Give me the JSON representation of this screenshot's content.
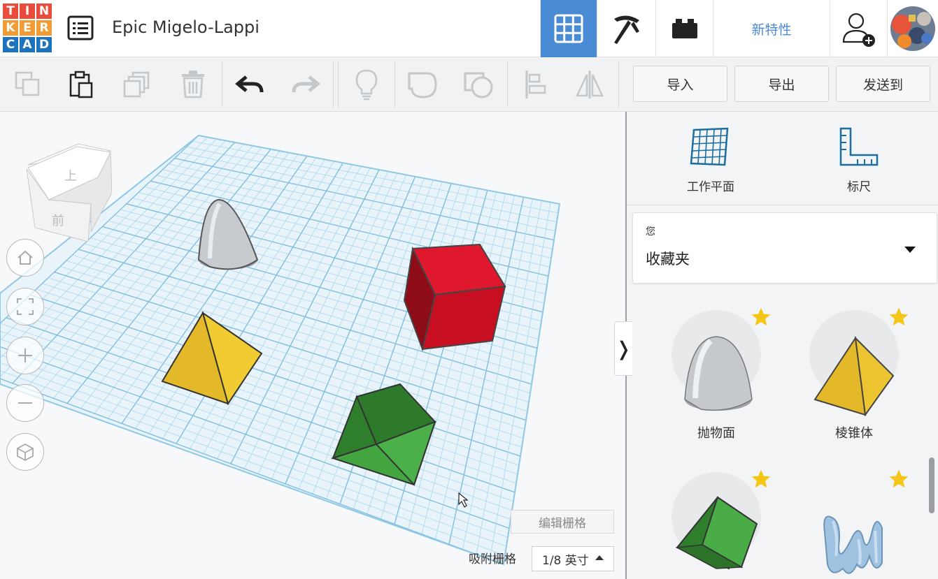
{
  "logo": {
    "letters": [
      "T",
      "I",
      "N",
      "K",
      "E",
      "R",
      "C",
      "A",
      "D"
    ],
    "colors": [
      "#e94b3c",
      "#e94b3c",
      "#e94b3c",
      "#f39c33",
      "#f39c33",
      "#f39c33",
      "#1e73be",
      "#1e73be",
      "#1e73be"
    ]
  },
  "header": {
    "project_title": "Epic Migelo-Lappi",
    "whats_new": "新特性"
  },
  "toolbar": {
    "import": "导入",
    "export": "导出",
    "send_to": "发送到"
  },
  "viewcube": {
    "top": "上",
    "front": "前"
  },
  "viewport": {
    "edit_grid": "编辑栅格",
    "snap_label": "吸附栅格",
    "snap_value": "1/8 英寸"
  },
  "panel": {
    "tools": [
      {
        "label": "工作平面",
        "icon": "workplane-icon"
      },
      {
        "label": "标尺",
        "icon": "ruler-icon"
      }
    ],
    "library": {
      "small": "您",
      "name": "收藏夹"
    },
    "shapes": [
      {
        "label": "抛物面",
        "icon": "paraboloid-icon"
      },
      {
        "label": "棱锥体",
        "icon": "pyramid-icon"
      },
      {
        "label": "",
        "icon": "roof-icon"
      },
      {
        "label": "",
        "icon": "scribble-icon"
      }
    ]
  },
  "colors": {
    "accent": "#4a8bd6",
    "red": "#d0021b",
    "yellow": "#e8c02b",
    "green": "#3d8c3a",
    "grid": "#8fc8e6"
  }
}
